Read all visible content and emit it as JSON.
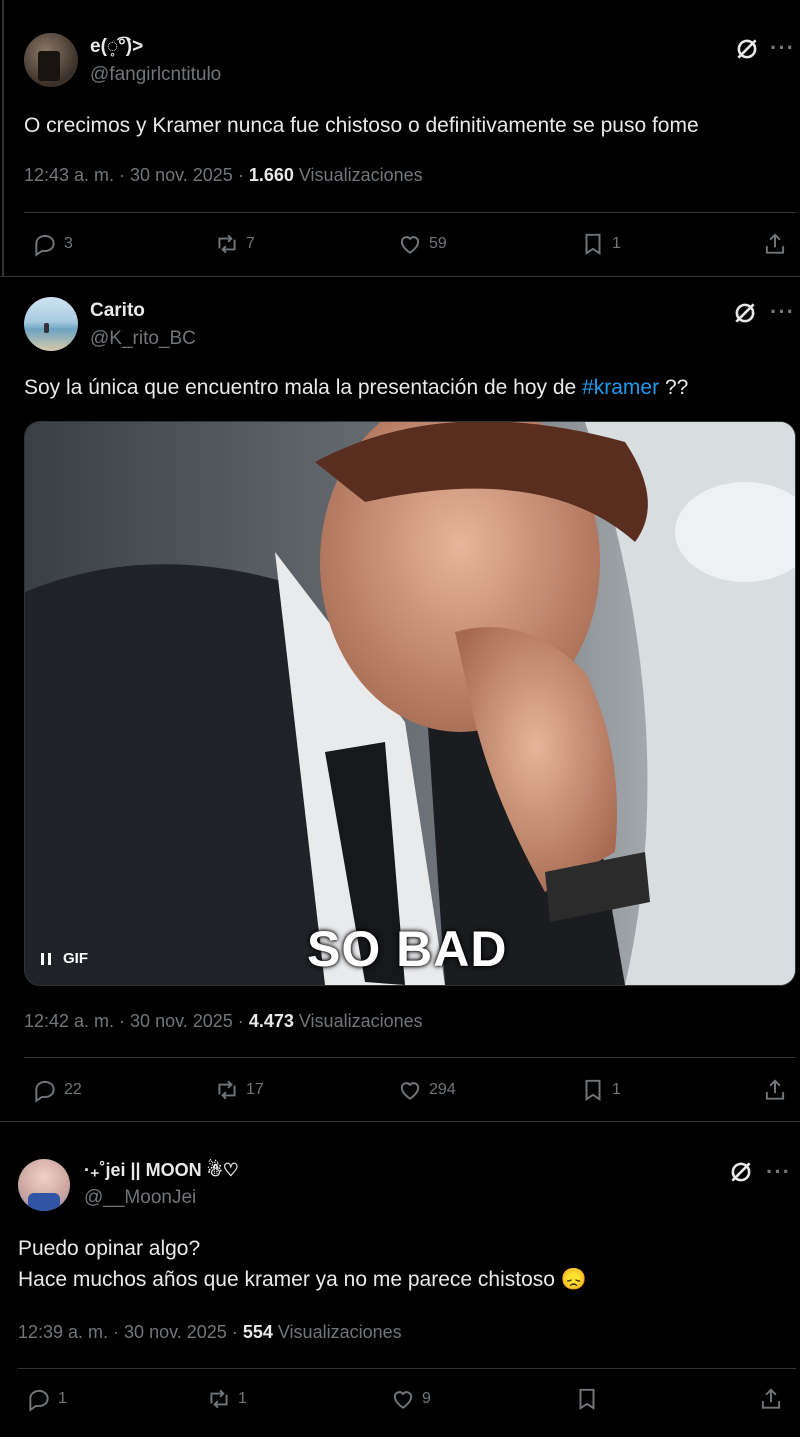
{
  "colors": {
    "background": "#000000",
    "text": "#e7e9ea",
    "muted": "#71767b",
    "link": "#1d9bf0",
    "divider": "#2f3336"
  },
  "tweets": [
    {
      "display_name": "e(◌̥͡°)>",
      "handle": "@fangirlcntitulo",
      "text": "O crecimos y Kramer nunca fue chistoso o definitivamente se puso fome",
      "time": "12:43 a. m. · 30 nov. 2025 ·",
      "views_count": "1.660",
      "views_label": "Visualizaciones",
      "replies": "3",
      "reposts": "7",
      "likes": "59",
      "bookmarks": "1"
    },
    {
      "display_name": "Carito",
      "handle": "@K_rito_BC",
      "text_before": "Soy la única que encuentro mala la presentación de hoy de",
      "hashtag": "#kramer",
      "text_after": "??",
      "media": {
        "type": "gif",
        "badge": "GIF",
        "overlay_text": "SO BAD"
      },
      "time": "12:42 a. m. · 30 nov. 2025 ·",
      "views_count": "4.473",
      "views_label": "Visualizaciones",
      "replies": "22",
      "reposts": "17",
      "likes": "294",
      "bookmarks": "1"
    },
    {
      "display_name": "·₊˚jei || MOON ☃︎♡",
      "handle": "@__MoonJei",
      "text_line1": "Puedo opinar algo?",
      "text_line2": "Hace muchos años que kramer ya no me parece chistoso",
      "emoji": "😞",
      "time": "12:39 a. m. · 30 nov. 2025 ·",
      "views_count": "554",
      "views_label": "Visualizaciones",
      "replies": "1",
      "reposts": "1",
      "likes": "9"
    }
  ],
  "icons": [
    "grok-icon",
    "more-icon",
    "reply-icon",
    "repost-icon",
    "like-icon",
    "bookmark-icon",
    "share-icon",
    "pause-icon"
  ]
}
